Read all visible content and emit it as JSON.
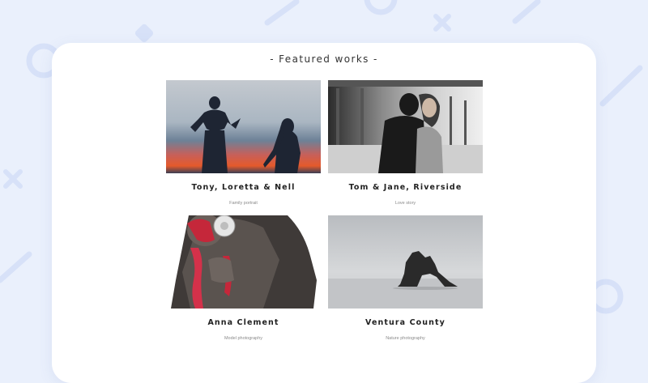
{
  "section": {
    "title": "- Featured works -"
  },
  "works": [
    {
      "title": "Tony, Loretta & Nell",
      "category": "Family portrait"
    },
    {
      "title": "Tom & Jane, Riverside",
      "category": "Love story"
    },
    {
      "title": "Anna Clement",
      "category": "Model photography"
    },
    {
      "title": "Ventura County",
      "category": "Nature photography"
    }
  ],
  "colors": {
    "background": "#eaf0fc",
    "card": "#ffffff",
    "decoration": "#d7e1f8"
  }
}
